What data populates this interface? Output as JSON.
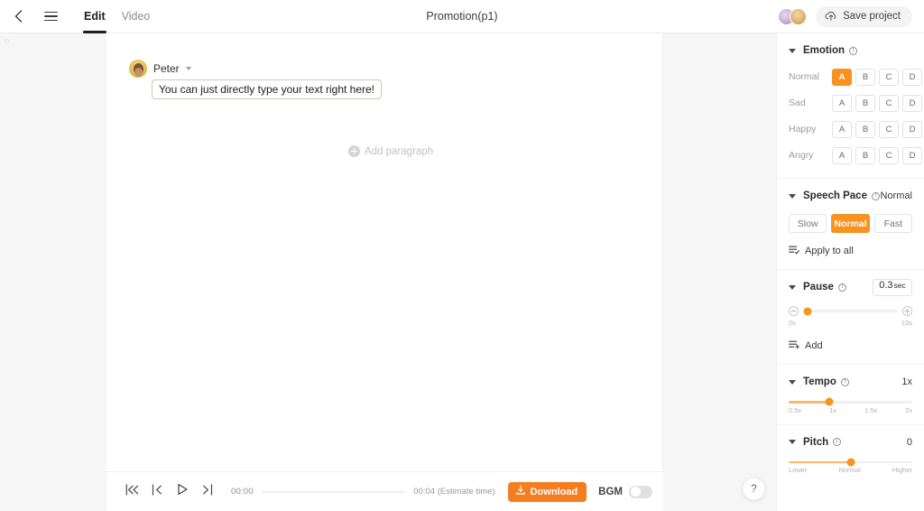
{
  "topbar": {
    "back_icon": "chevron-left-icon",
    "menu_icon": "hamburger-menu-icon",
    "tabs": [
      {
        "label": "Edit",
        "active": true
      },
      {
        "label": "Video",
        "active": false
      }
    ],
    "title": "Promotion(p1)",
    "save_label": "Save project",
    "save_icon": "upload-cloud-icon"
  },
  "editor": {
    "speaker_name": "Peter",
    "speaker_avatar": "user-avatar",
    "paragraph_text": "You can just directly type your text right here!",
    "add_paragraph_label": "Add paragraph",
    "add_paragraph_icon": "plus-circle-icon"
  },
  "player": {
    "skip_start_icon": "skip-to-start-icon",
    "prev_icon": "previous-icon",
    "play_icon": "play-icon",
    "next_icon": "next-icon",
    "current_time": "00:00",
    "estimate_time": "00:04 (Estimate time)",
    "download_label": "Download",
    "download_icon": "download-icon",
    "bgm_label": "BGM",
    "bgm_on": false,
    "progress_percent": 0
  },
  "help": {
    "label": "?"
  },
  "panel": {
    "emotion": {
      "title": "Emotion",
      "rows": [
        {
          "label": "Normal",
          "options": [
            "A",
            "B",
            "C",
            "D"
          ],
          "selected": "A"
        },
        {
          "label": "Sad",
          "options": [
            "A",
            "B",
            "C",
            "D"
          ],
          "selected": null
        },
        {
          "label": "Happy",
          "options": [
            "A",
            "B",
            "C",
            "D"
          ],
          "selected": null
        },
        {
          "label": "Angry",
          "options": [
            "A",
            "B",
            "C",
            "D"
          ],
          "selected": null
        }
      ]
    },
    "speech_pace": {
      "title": "Speech Pace",
      "value": "Normal",
      "options": [
        "Slow",
        "Normal",
        "Fast"
      ],
      "selected": "Normal",
      "apply_all_label": "Apply to all",
      "apply_all_icon": "apply-to-all-icon"
    },
    "pause": {
      "title": "Pause",
      "value_num": "0.3",
      "value_unit": "sec",
      "min_label": "0s",
      "max_label": "10s",
      "slider_percent": 4,
      "minus_icon": "minus-circle-icon",
      "plus_icon": "plus-circle-icon",
      "add_label": "Add",
      "add_icon": "add-pause-icon"
    },
    "tempo": {
      "title": "Tempo",
      "value": "1x",
      "ticks": [
        "0.5x",
        "1x",
        "1.5x",
        "2x"
      ],
      "slider_percent": 33
    },
    "pitch": {
      "title": "Pitch",
      "value": "0",
      "ticks": [
        "Lower",
        "Normal",
        "Higher"
      ],
      "slider_percent": 50
    }
  },
  "colors": {
    "accent": "#f7931e",
    "download": "#f47d20",
    "panel_bg": "#ffffff",
    "app_bg": "#f6f6f6"
  }
}
